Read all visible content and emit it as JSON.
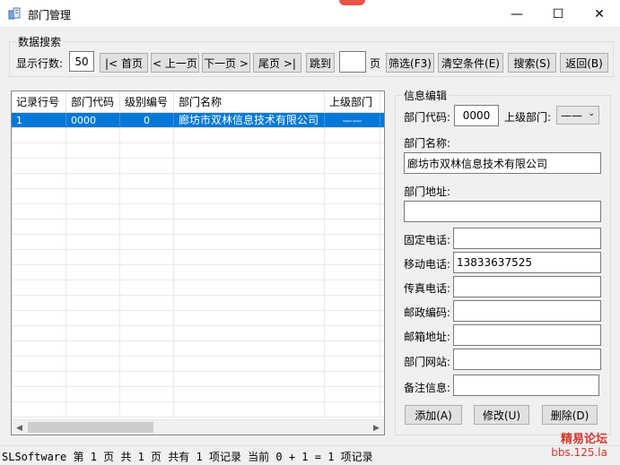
{
  "window": {
    "title": "部门管理",
    "minimize": "—",
    "maximize": "☐",
    "close": "✕"
  },
  "search": {
    "legend": "数据搜索",
    "rows_label": "显示行数:",
    "rows_value": "50",
    "first": "|< 首页",
    "prev": "< 上一页",
    "next": "下一页 >",
    "last": "尾页 >|",
    "jump": "跳到",
    "page_value": "",
    "page_suffix": "页",
    "filter": "筛选(F3)",
    "clear": "清空条件(E)",
    "search_btn": "搜索(S)",
    "back": "返回(B)"
  },
  "table": {
    "columns": [
      "记录行号",
      "部门代码",
      "级别编号",
      "部门名称",
      "上级部门",
      "|"
    ],
    "rows": [
      [
        "1",
        "0000",
        "0",
        "廊坊市双林信息技术有限公司",
        "——",
        ""
      ]
    ],
    "scroll_left": "◀",
    "scroll_right": "▶"
  },
  "edit": {
    "legend": "信息编辑",
    "code_label": "部门代码:",
    "code_value": "0000",
    "parent_label": "上级部门:",
    "parent_value": "——",
    "name_label": "部门名称:",
    "name_value": "廊坊市双林信息技术有限公司",
    "address_label": "部门地址:",
    "address_value": "",
    "phone_label": "固定电话:",
    "phone_value": "",
    "mobile_label": "移动电话:",
    "mobile_value": "13833637525",
    "fax_label": "传真电话:",
    "fax_value": "",
    "zip_label": "邮政编码:",
    "zip_value": "",
    "email_label": "邮箱地址:",
    "email_value": "",
    "website_label": "部门网站:",
    "website_value": "",
    "notes_label": "备注信息:",
    "notes_value": "",
    "add": "添加(A)",
    "modify": "修改(U)",
    "delete": "删除(D)"
  },
  "status": {
    "text": "SLSoftware 第 1 页 共 1 页 共有 1 项记录 当前 0 + 1 = 1 项记录"
  },
  "watermark": {
    "line1": "精易论坛",
    "line2": "bbs.125.la"
  }
}
